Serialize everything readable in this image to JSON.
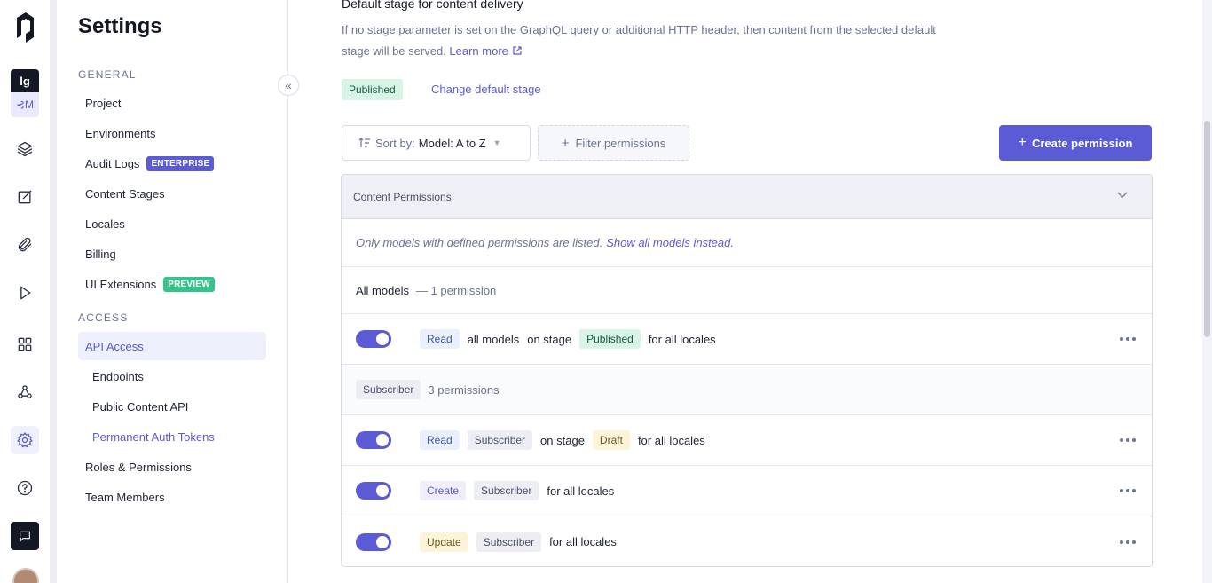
{
  "rail": {
    "project_badge": "lg",
    "env_badge": "M",
    "env_branch_icon": "⊰",
    "icons": [
      "schema-icon",
      "content-icon",
      "assets-icon",
      "playground-icon",
      "apps-icon",
      "webhooks-icon",
      "settings-icon",
      "help-icon",
      "chat-icon"
    ],
    "accent": "#5b5bd6"
  },
  "sidebar": {
    "title": "Settings",
    "general_label": "GENERAL",
    "access_label": "ACCESS",
    "items": {
      "project": "Project",
      "environments": "Environments",
      "audit_logs": "Audit Logs",
      "audit_badge": "ENTERPRISE",
      "content_stages": "Content Stages",
      "locales": "Locales",
      "billing": "Billing",
      "ui_extensions": "UI Extensions",
      "ui_badge": "PREVIEW",
      "api_access": "API Access",
      "endpoints": "Endpoints",
      "public_content_api": "Public Content API",
      "permanent_auth_tokens": "Permanent Auth Tokens",
      "roles_permissions": "Roles & Permissions",
      "team_members": "Team Members"
    },
    "collapse_glyph": "«"
  },
  "main": {
    "stage_heading": "Default stage for content delivery",
    "stage_desc": "If no stage parameter is set on the GraphQL query or additional HTTP header, then content from the selected default stage will be served.",
    "learn_more": "Learn more",
    "published_tag": "Published",
    "change_stage": "Change default stage",
    "sort_prefix": "Sort by:",
    "sort_value": "Model: A to Z",
    "filter_label": "Filter permissions",
    "create_label": "Create permission",
    "table_title": "Content Permissions",
    "info_text": "Only models with defined permissions are listed.",
    "info_link": "Show all models instead.",
    "group_all": {
      "name": "All models",
      "count": "— 1 permission"
    },
    "group_subscriber": {
      "name": "Subscriber",
      "count": "3 permissions"
    },
    "perms": [
      {
        "action": "Read",
        "model": "all models",
        "on": "on stage",
        "stage": "Published",
        "locales": "for all locales"
      },
      {
        "action": "Read",
        "model": "Subscriber",
        "on": "on stage",
        "stage": "Draft",
        "locales": "for all locales"
      },
      {
        "action": "Create",
        "model": "Subscriber",
        "locales": "for all locales"
      },
      {
        "action": "Update",
        "model": "Subscriber",
        "locales": "for all locales"
      }
    ]
  }
}
